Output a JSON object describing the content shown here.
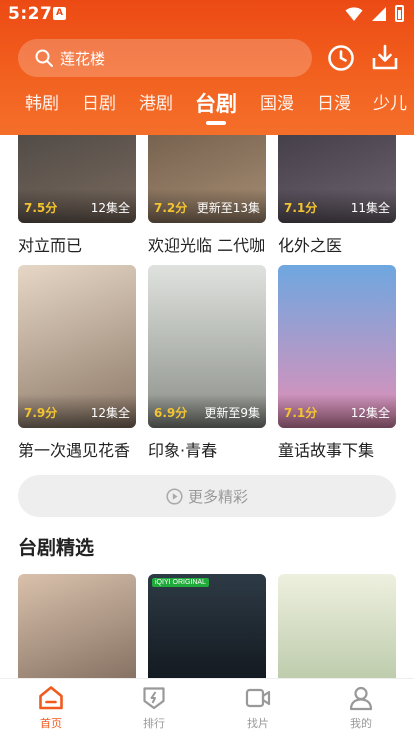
{
  "status": {
    "time": "5:27",
    "app_badge": "A"
  },
  "search": {
    "text": "莲花楼"
  },
  "tabs": [
    {
      "label": "韩剧"
    },
    {
      "label": "日剧"
    },
    {
      "label": "港剧"
    },
    {
      "label": "台剧"
    },
    {
      "label": "国漫"
    },
    {
      "label": "日漫"
    },
    {
      "label": "少儿"
    }
  ],
  "grid": [
    {
      "title": "对立而已",
      "score": "7.5分",
      "badge": "12集全",
      "colors": [
        "#3a3a3a",
        "#7a6a5e"
      ]
    },
    {
      "title": "欢迎光临 二代咖",
      "score": "7.2分",
      "badge": "更新至13集",
      "colors": [
        "#5b4a3c",
        "#a78d73"
      ]
    },
    {
      "title": "化外之医",
      "score": "7.1分",
      "badge": "11集全",
      "colors": [
        "#2e2b33",
        "#6e6470"
      ]
    },
    {
      "title": "第一次遇见花香",
      "score": "7.9分",
      "badge": "12集全",
      "colors": [
        "#d8c7b6",
        "#8b7766"
      ]
    },
    {
      "title": "印象·青春",
      "score": "6.9分",
      "badge": "更新至9集",
      "colors": [
        "#cfd3cf",
        "#8b8f88"
      ]
    },
    {
      "title": "童话故事下集",
      "score": "7.1分",
      "badge": "12集全",
      "colors": [
        "#6ea7e0",
        "#e58fb6"
      ]
    }
  ],
  "more_button": {
    "label": "更多精彩"
  },
  "section": {
    "title": "台剧精选"
  },
  "featured": [
    {
      "colors": [
        "#d9c1ac",
        "#7e6a5c"
      ]
    },
    {
      "colors": [
        "#2d3a45",
        "#10151b"
      ],
      "tag": "iQIYI ORIGINAL"
    },
    {
      "colors": [
        "#e9ecd9",
        "#b7c7a5"
      ]
    }
  ],
  "nav": [
    {
      "label": "首页",
      "icon": "home-icon"
    },
    {
      "label": "排行",
      "icon": "ranking-icon"
    },
    {
      "label": "找片",
      "icon": "video-icon"
    },
    {
      "label": "我的",
      "icon": "profile-icon"
    }
  ],
  "theme": {
    "accent": "#f15a1e",
    "header_top": "#ec4a14",
    "score": "#f4c430"
  }
}
